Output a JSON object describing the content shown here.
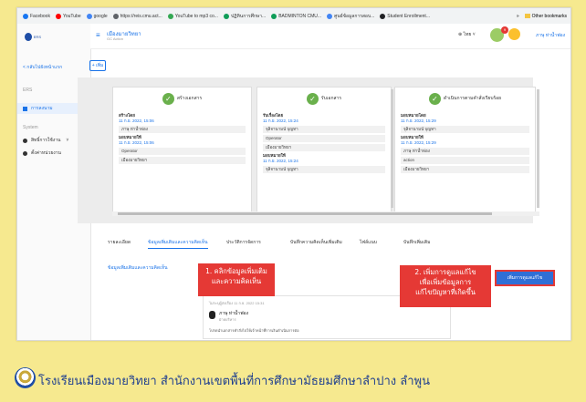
{
  "bookmarks": [
    {
      "label": "Facebook",
      "color": "#1877f2"
    },
    {
      "label": "YouTube",
      "color": "#ff0000"
    },
    {
      "label": "google",
      "color": "#4285f4"
    },
    {
      "label": "https://reis.cmu.act...",
      "color": "#5f6368"
    },
    {
      "label": "YouTube to mp3 co...",
      "color": "#34a853"
    },
    {
      "label": "ปฏิทินการศึกษา...",
      "color": "#0f9d58"
    },
    {
      "label": "BADMINTON CMU...",
      "color": "#0f9d58"
    },
    {
      "label": "ศูนย์ข้อมูลการสอบ...",
      "color": "#4285f4"
    },
    {
      "label": "Student Enrollment...",
      "color": "#202124"
    }
  ],
  "bookmarks_more": "»",
  "bookmarks_other": "Other bookmarks",
  "sidebar": {
    "back_label": "< กลับไปยังหน้าแรก",
    "section1": "ERS",
    "active_item": "การลงนาม",
    "section2": "System",
    "items": [
      "สิทธิ์การใช้งาน",
      "ตั้งค่าหน่วยงาน"
    ]
  },
  "topbar": {
    "title": "เมืองมายวิทยา",
    "subtitle": "GC Action",
    "lang": "ไทย",
    "notif_count": "9",
    "user": "ภาษุ ห่าน้ำฟอง"
  },
  "add_label": "+ เพิ่ม",
  "workflow": [
    {
      "header": "สร้างเอกสาร",
      "lines": [
        {
          "t": "lbl",
          "v": "สร้างโดย"
        },
        {
          "t": "dt",
          "v": "11 ก.ย. 2022, 15:06"
        },
        {
          "t": "box",
          "v": "ภาษุ ห่าน้ำฟอง"
        },
        {
          "t": "lbl",
          "v": "มอบหมายให้"
        },
        {
          "t": "dt",
          "v": "11 ก.ย. 2022, 15:06"
        },
        {
          "t": "box",
          "v": "Operator"
        },
        {
          "t": "box",
          "v": "เมืองมายวิทยา"
        }
      ]
    },
    {
      "header": "รับเอกสาร",
      "lines": [
        {
          "t": "lbl",
          "v": "รับเรื่องโดย"
        },
        {
          "t": "dt",
          "v": "11 ก.ย. 2022, 15:24"
        },
        {
          "t": "box",
          "v": "จุลิจานามน์ บุญทา"
        },
        {
          "t": "box",
          "v": "Operator"
        },
        {
          "t": "box",
          "v": "เมืองมายวิทยา"
        },
        {
          "t": "lbl",
          "v": "มอบหมายให้"
        },
        {
          "t": "dt",
          "v": "11 ก.ย. 2022, 15:24"
        },
        {
          "t": "box",
          "v": "จุลิจานามน์ บุญทา"
        }
      ]
    },
    {
      "header": "ดำเนินการตามคำสั่งเรียบร้อย",
      "lines": [
        {
          "t": "lbl",
          "v": "มอบหมายโดย"
        },
        {
          "t": "dt",
          "v": "11 ก.ย. 2022, 15:29"
        },
        {
          "t": "box",
          "v": "จุลิจานามน์ บุญทา"
        },
        {
          "t": "lbl",
          "v": "มอบหมายให้"
        },
        {
          "t": "dt",
          "v": "11 ก.ย. 2022, 15:29"
        },
        {
          "t": "box",
          "v": "ภาษุ ห่าน้ำฟอง"
        },
        {
          "t": "box",
          "v": "action"
        },
        {
          "t": "box",
          "v": "เมืองมายวิทยา"
        }
      ]
    }
  ],
  "tabs": [
    "รายละเอียด",
    "ข้อมูลเพิ่มเติมและความคิดเห็น",
    "ประวัติการจัดการ",
    "บันทึกความคิดเห็นเพิ่มเติม",
    "ไฟล์แนบ",
    "บันทึกเพิ่มเติม"
  ],
  "content": {
    "title": "ข้อมูลเพิ่มเติมและความคิดเห็น",
    "card_meta": "ไม่ระบุผู้ส่งเรื่อง 11 ก.ย. 2022 15:31",
    "person_name": "ภาษุ ห่าน้ำฟอง",
    "person_sub": "ฝ่ายบริหาร",
    "comment": "โปรดนำเอกสารคำสั่งไปให้เจ้าหน้าที่การเงินดำเนินการต่อ"
  },
  "edit_button": "เพิ่มการดูแลแก้ไข",
  "annotations": {
    "a1": [
      "1. คลิกข้อมูลเพิ่มเติม",
      "และความคิดเห็น"
    ],
    "a2": [
      "2. เพิ่มการดูแลแก้ไข",
      "เพื่อเพิ่มข้อมูลการ",
      "แก้ไขปัญหาที่เกิดขึ้น"
    ]
  },
  "footer_text": "โรงเรียนเมืองมายวิทยา  สำนักงานเขตพื้นที่การศึกษามัธยมศึกษาลำปาง  ลำพูน"
}
